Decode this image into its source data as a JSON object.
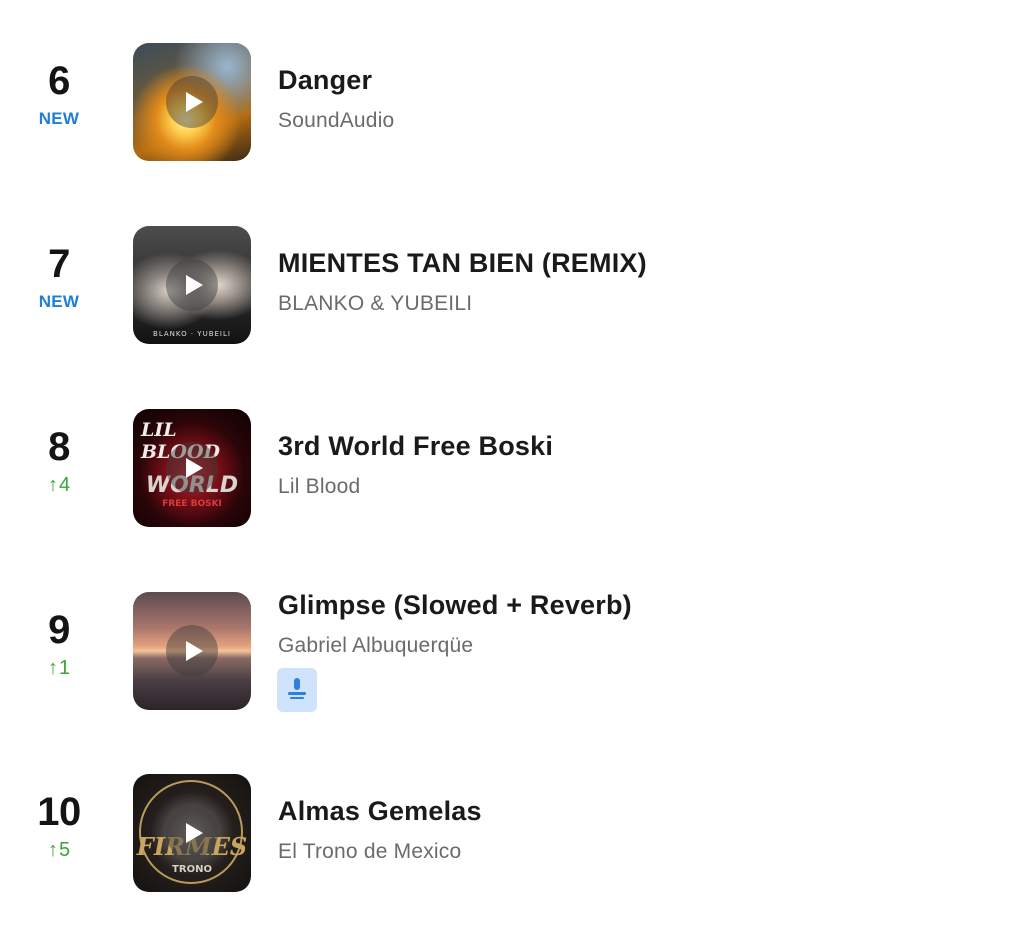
{
  "chart": {
    "entries": [
      {
        "rank": "6",
        "change": "NEW",
        "change_type": "new",
        "title": "Danger",
        "artist": "SoundAudio",
        "artwork_icon": "danger-artwork"
      },
      {
        "rank": "7",
        "change": "NEW",
        "change_type": "new",
        "title": "MIENTES TAN BIEN (REMIX)",
        "artist": "BLANKO & YUBEILI",
        "artwork_icon": "mientes-artwork",
        "artwork_text": "BLANKO · YUBEILI"
      },
      {
        "rank": "8",
        "change": "4",
        "change_type": "up",
        "title": "3rd World Free Boski",
        "artist": "Lil Blood",
        "artwork_icon": "boski-artwork",
        "artwork_text_top": "LIL BLOOD",
        "artwork_text_mid": "WORLD",
        "artwork_text_bottom": "FREE BOSKI"
      },
      {
        "rank": "9",
        "change": "1",
        "change_type": "up",
        "title": "Glimpse (Slowed + Reverb)",
        "artist": "Gabriel Albuquerqüe",
        "artwork_icon": "glimpse-artwork",
        "has_download": true,
        "download_icon": "download-icon"
      },
      {
        "rank": "10",
        "change": "5",
        "change_type": "up",
        "title": "Almas Gemelas",
        "artist": "El Trono de Mexico",
        "artwork_icon": "almas-artwork",
        "artwork_text_mid": "FIRMES",
        "artwork_text_bottom": "TRONO"
      }
    ],
    "up_arrow": "↑"
  },
  "colors": {
    "new_badge": "#1f7fd6",
    "up_change": "#3aa53a",
    "title": "#1a1a1a",
    "artist": "#6b6b6b",
    "download_bg": "#cfe3fb",
    "download_fg": "#2f7fe0"
  }
}
